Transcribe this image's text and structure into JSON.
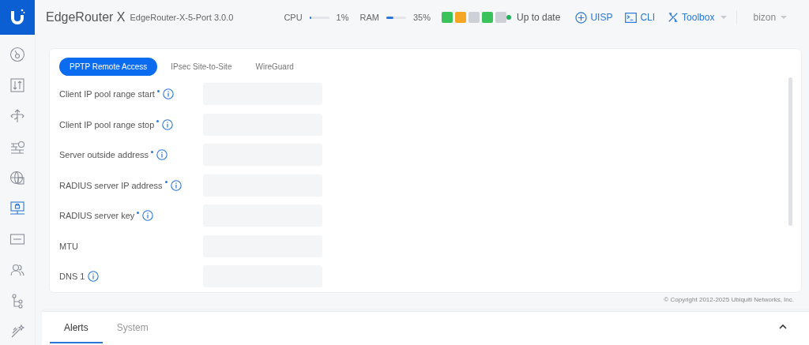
{
  "header": {
    "product": "EdgeRouter X",
    "model": "EdgeRouter-X-5-Port 3.0.0",
    "cpu": {
      "label": "CPU",
      "level": 0.01,
      "reading": "1%"
    },
    "ram": {
      "label": "RAM",
      "level": 0.35,
      "reading": "35%"
    },
    "ports": [
      {
        "color": "#3cc25a"
      },
      {
        "color": "#f5a623"
      },
      {
        "color": "#cdd0d6"
      },
      {
        "color": "#3cc25a"
      },
      {
        "color": "#cdd0d6"
      }
    ],
    "update_status": "Up to date",
    "links": [
      "UISP",
      "CLI",
      "Toolbox"
    ],
    "user": "bizon"
  },
  "sidebar": {
    "items": [
      {
        "selected": false
      },
      {
        "selected": false
      },
      {
        "selected": false
      },
      {
        "selected": false
      },
      {
        "selected": false
      },
      {
        "selected": true
      },
      {
        "selected": false
      },
      {
        "selected": false
      },
      {
        "selected": false
      },
      {
        "selected": false
      }
    ]
  },
  "tabs": [
    {
      "label": "PPTP Remote Access",
      "selected": true
    },
    {
      "label": "IPsec Site-to-Site",
      "selected": false
    },
    {
      "label": "WireGuard",
      "selected": false
    }
  ],
  "fields": [
    {
      "label": "Client IP pool range start",
      "required": true,
      "info": true
    },
    {
      "label": "Client IP pool range stop",
      "required": true,
      "info": true
    },
    {
      "label": "Server outside address",
      "required": true,
      "info": true
    },
    {
      "label": "RADIUS server IP address",
      "required": true,
      "info": true
    },
    {
      "label": "RADIUS server key",
      "required": true,
      "info": true
    },
    {
      "label": "MTU",
      "required": false,
      "info": false
    },
    {
      "label": "DNS 1",
      "required": false,
      "info": true
    }
  ],
  "copyright": "© Copyright 2012-2025 Ubiquiti Networks, Inc.",
  "bottom_tabs": [
    {
      "label": "Alerts",
      "selected": true
    },
    {
      "label": "System",
      "selected": false
    }
  ]
}
